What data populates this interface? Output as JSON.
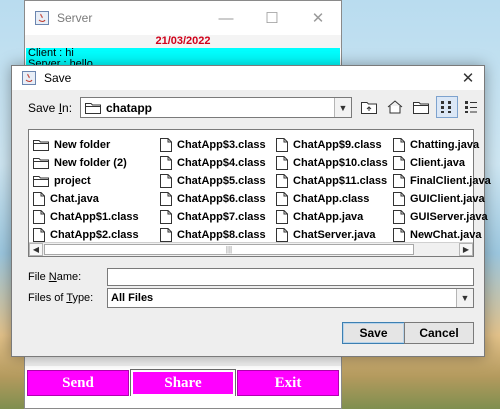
{
  "server_window": {
    "title": "Server",
    "date": "21/03/2022",
    "chat_lines": [
      "Client : hi",
      "Server : hello"
    ],
    "buttons": {
      "send": "Send",
      "share": "Share",
      "exit": "Exit"
    },
    "controls": {
      "minimize": "—",
      "maximize": "☐",
      "close": "✕"
    }
  },
  "save_dialog": {
    "title": "Save",
    "close_glyph": "✕",
    "save_in_prefix": "Save ",
    "save_in_accel": "I",
    "save_in_suffix": "n:",
    "current_folder": "chatapp",
    "toolbar_icons": [
      "up-one-level-icon",
      "home-icon",
      "new-folder-icon",
      "list-view-icon",
      "details-view-icon"
    ],
    "files": {
      "col1": [
        {
          "name": "New folder",
          "icon": "folder-icon"
        },
        {
          "name": "New folder (2)",
          "icon": "folder-icon"
        },
        {
          "name": "project",
          "icon": "folder-icon"
        },
        {
          "name": "Chat.java",
          "icon": "file-icon"
        },
        {
          "name": "ChatApp$1.class",
          "icon": "file-icon"
        },
        {
          "name": "ChatApp$2.class",
          "icon": "file-icon"
        }
      ],
      "col2": [
        {
          "name": "ChatApp$3.class",
          "icon": "file-icon"
        },
        {
          "name": "ChatApp$4.class",
          "icon": "file-icon"
        },
        {
          "name": "ChatApp$5.class",
          "icon": "file-icon"
        },
        {
          "name": "ChatApp$6.class",
          "icon": "file-icon"
        },
        {
          "name": "ChatApp$7.class",
          "icon": "file-icon"
        },
        {
          "name": "ChatApp$8.class",
          "icon": "file-icon"
        }
      ],
      "col3": [
        {
          "name": "ChatApp$9.class",
          "icon": "file-icon"
        },
        {
          "name": "ChatApp$10.class",
          "icon": "file-icon"
        },
        {
          "name": "ChatApp$11.class",
          "icon": "file-icon"
        },
        {
          "name": "ChatApp.class",
          "icon": "file-icon"
        },
        {
          "name": "ChatApp.java",
          "icon": "file-icon"
        },
        {
          "name": "ChatServer.java",
          "icon": "file-icon"
        }
      ],
      "col4": [
        {
          "name": "Chatting.java",
          "icon": "file-icon"
        },
        {
          "name": "Client.java",
          "icon": "file-icon"
        },
        {
          "name": "FinalClient.java",
          "icon": "file-icon"
        },
        {
          "name": "GUIClient.java",
          "icon": "file-icon"
        },
        {
          "name": "GUIServer.java",
          "icon": "file-icon"
        },
        {
          "name": "NewChat.java",
          "icon": "file-icon"
        }
      ]
    },
    "file_name_label_prefix": "File ",
    "file_name_label_accel": "N",
    "file_name_label_suffix": "ame:",
    "file_name_value": "",
    "files_of_type_label_prefix": "Files of ",
    "files_of_type_label_accel": "T",
    "files_of_type_label_suffix": "ype:",
    "files_of_type_value": "All Files",
    "save_button": "Save",
    "cancel_button": "Cancel"
  },
  "colors": {
    "chat_background": "#00ffff",
    "date_text": "#d0021b",
    "action_button": "#ff00ff"
  }
}
